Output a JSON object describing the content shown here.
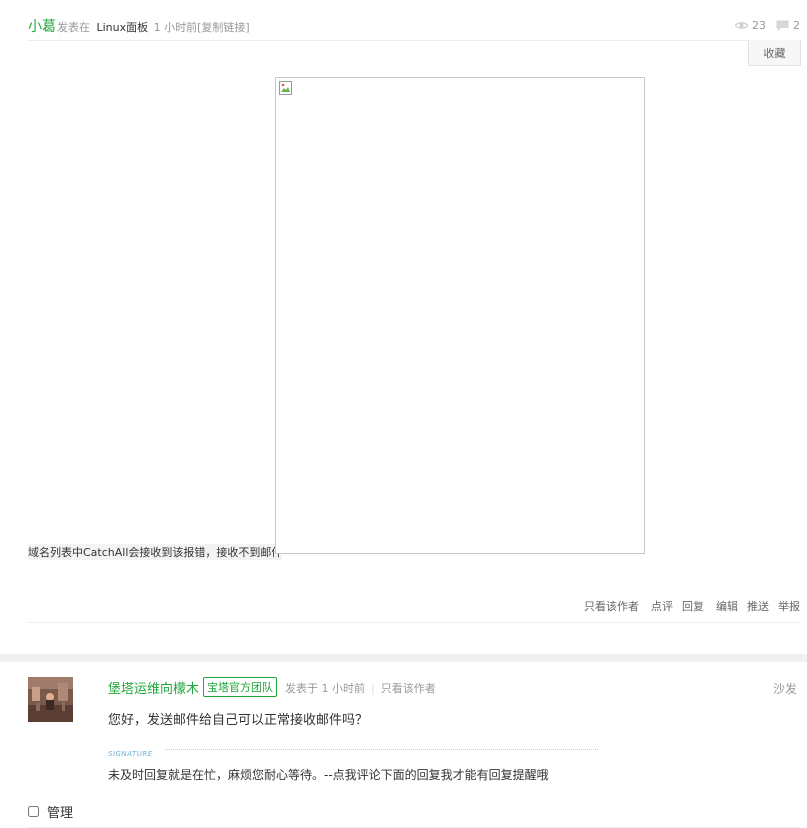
{
  "post": {
    "author": "小葛",
    "posted_in_label": "发表在",
    "forum": "Linux面板",
    "time": "1 小时前",
    "copy_link": "[复制链接]",
    "views": "23",
    "comments": "2",
    "favorite_label": "收藏",
    "content_text": "域名列表中CatchAll会接收到该报错，接收不到邮件",
    "actions": {
      "only_author": "只看该作者",
      "rate": "点评",
      "reply": "回复",
      "edit": "编辑",
      "push": "推送",
      "report": "举报"
    }
  },
  "reply": {
    "author": "堡塔运维向檬木",
    "badge": "宝塔官方团队",
    "posted_label": "发表于 1 小时前",
    "only_author": "只看该作者",
    "floor": "沙发",
    "content": "您好，发送邮件给自己可以正常接收邮件吗？",
    "signature_label": "SIGNATURE",
    "signature": "未及时回复就是在忙，麻烦您耐心等待。--点我评论下面的回复我才能有回复提醒哦"
  },
  "manage": {
    "label": "管理"
  },
  "colors": {
    "brand_green": "#20a53a",
    "muted": "#999999"
  },
  "icons": [
    "eye-icon",
    "comment-icon",
    "broken-image-icon"
  ]
}
